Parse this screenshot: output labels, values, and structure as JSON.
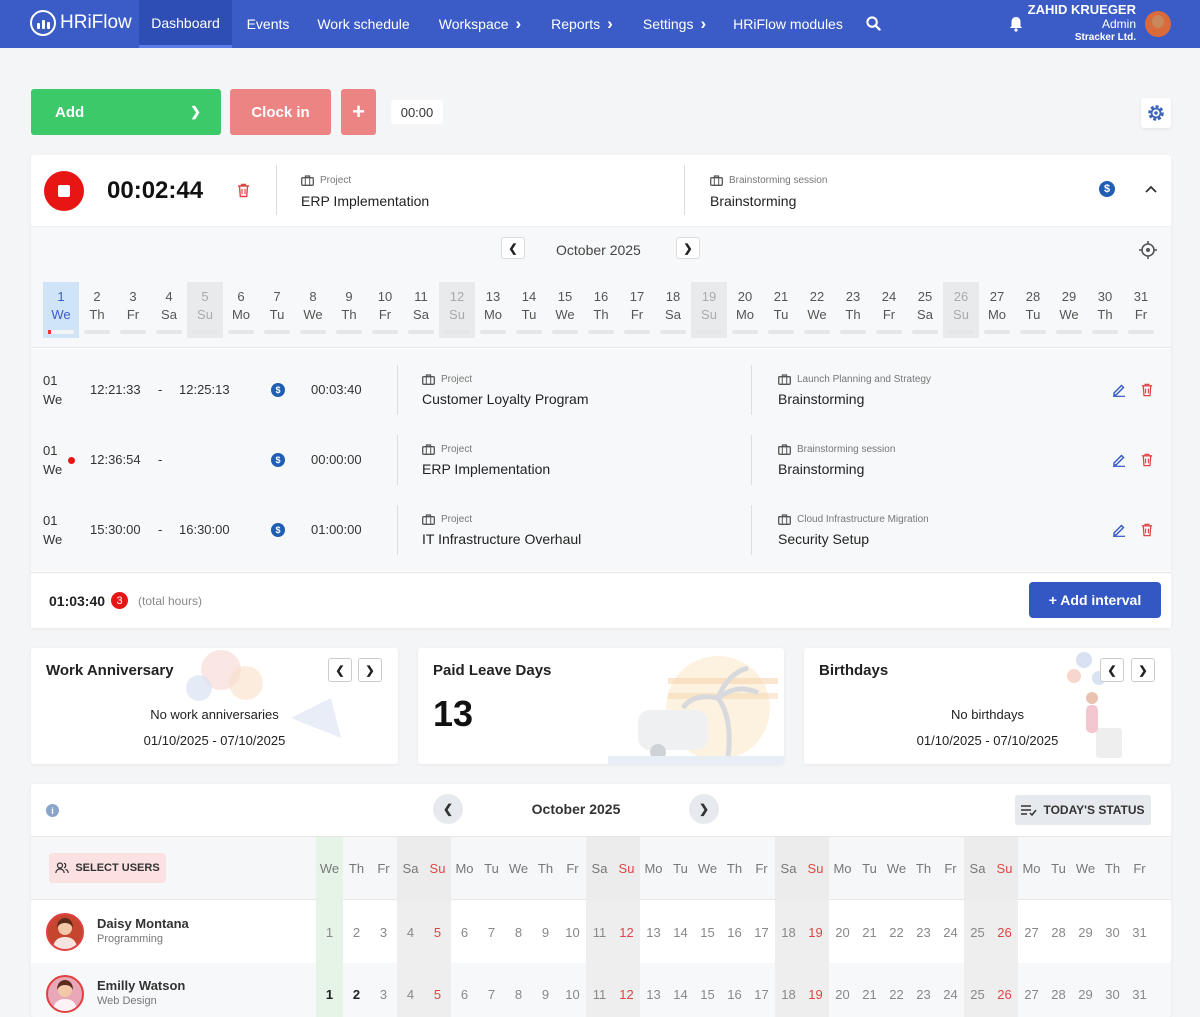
{
  "nav": {
    "brand": "HRiFlow",
    "items": [
      {
        "label": "Dashboard",
        "chevron": false
      },
      {
        "label": "Events",
        "chevron": false
      },
      {
        "label": "Work schedule",
        "chevron": false
      },
      {
        "label": "Workspace",
        "chevron": true
      },
      {
        "label": "Reports",
        "chevron": true
      },
      {
        "label": "Settings",
        "chevron": true
      },
      {
        "label": "HRiFlow modules",
        "chevron": false
      }
    ],
    "user": {
      "name": "ZAHID KRUEGER",
      "role": "Admin",
      "company": "Stracker Ltd."
    }
  },
  "actions": {
    "add": "Add",
    "clock_in": "Clock in",
    "plus": "+",
    "time": "00:00"
  },
  "tracker": {
    "elapsed": "00:02:44",
    "project_label": "Project",
    "project_value": "ERP Implementation",
    "task_label": "Brainstorming session",
    "task_value": "Brainstorming",
    "currency_symbol": "$"
  },
  "calendar": {
    "month": "October 2025",
    "days": [
      {
        "n": "1",
        "w": "We",
        "type": "today"
      },
      {
        "n": "2",
        "w": "Th",
        "type": ""
      },
      {
        "n": "3",
        "w": "Fr",
        "type": ""
      },
      {
        "n": "4",
        "w": "Sa",
        "type": ""
      },
      {
        "n": "5",
        "w": "Su",
        "type": "weekend"
      },
      {
        "n": "6",
        "w": "Mo",
        "type": ""
      },
      {
        "n": "7",
        "w": "Tu",
        "type": ""
      },
      {
        "n": "8",
        "w": "We",
        "type": ""
      },
      {
        "n": "9",
        "w": "Th",
        "type": ""
      },
      {
        "n": "10",
        "w": "Fr",
        "type": ""
      },
      {
        "n": "11",
        "w": "Sa",
        "type": ""
      },
      {
        "n": "12",
        "w": "Su",
        "type": "weekend"
      },
      {
        "n": "13",
        "w": "Mo",
        "type": ""
      },
      {
        "n": "14",
        "w": "Tu",
        "type": ""
      },
      {
        "n": "15",
        "w": "We",
        "type": ""
      },
      {
        "n": "16",
        "w": "Th",
        "type": ""
      },
      {
        "n": "17",
        "w": "Fr",
        "type": ""
      },
      {
        "n": "18",
        "w": "Sa",
        "type": ""
      },
      {
        "n": "19",
        "w": "Su",
        "type": "weekend"
      },
      {
        "n": "20",
        "w": "Mo",
        "type": ""
      },
      {
        "n": "21",
        "w": "Tu",
        "type": ""
      },
      {
        "n": "22",
        "w": "We",
        "type": ""
      },
      {
        "n": "23",
        "w": "Th",
        "type": ""
      },
      {
        "n": "24",
        "w": "Fr",
        "type": ""
      },
      {
        "n": "25",
        "w": "Sa",
        "type": ""
      },
      {
        "n": "26",
        "w": "Su",
        "type": "weekend"
      },
      {
        "n": "27",
        "w": "Mo",
        "type": ""
      },
      {
        "n": "28",
        "w": "Tu",
        "type": ""
      },
      {
        "n": "29",
        "w": "We",
        "type": ""
      },
      {
        "n": "30",
        "w": "Th",
        "type": ""
      },
      {
        "n": "31",
        "w": "Fr",
        "type": ""
      }
    ]
  },
  "intervals": [
    {
      "day": "01",
      "weekday": "We",
      "start": "12:21:33",
      "dash": "-",
      "end": "12:25:13",
      "duration": "00:03:40",
      "project_label": "Project",
      "project": "Customer Loyalty Program",
      "task_label": "Launch Planning and Strategy",
      "task": "Brainstorming",
      "recording": false
    },
    {
      "day": "01",
      "weekday": "We",
      "start": "12:36:54",
      "dash": "-",
      "end": "",
      "duration": "00:00:00",
      "project_label": "Project",
      "project": "ERP Implementation",
      "task_label": "Brainstorming session",
      "task": "Brainstorming",
      "recording": true
    },
    {
      "day": "01",
      "weekday": "We",
      "start": "15:30:00",
      "dash": "-",
      "end": "16:30:00",
      "duration": "01:00:00",
      "project_label": "Project",
      "project": "IT Infrastructure Overhaul",
      "task_label": "Cloud Infrastructure Migration",
      "task": "Security Setup",
      "recording": false
    }
  ],
  "totals": {
    "hours": "01:03:40",
    "count": "3",
    "caption": "(total hours)",
    "add_interval": "+ Add interval"
  },
  "widgets": {
    "anniversary": {
      "title": "Work Anniversary",
      "message": "No work anniversaries",
      "range": "01/10/2025 - 07/10/2025"
    },
    "paid_leave": {
      "title": "Paid Leave Days",
      "value": "13"
    },
    "birthdays": {
      "title": "Birthdays",
      "message": "No birthdays",
      "range": "01/10/2025 - 07/10/2025"
    }
  },
  "team": {
    "month": "October 2025",
    "status_button": "TODAY'S STATUS",
    "select_users": "SELECT USERS",
    "info": "i",
    "columns": [
      {
        "w": "We",
        "n": "1",
        "t": "today"
      },
      {
        "w": "Th",
        "n": "2",
        "t": ""
      },
      {
        "w": "Fr",
        "n": "3",
        "t": ""
      },
      {
        "w": "Sa",
        "n": "4",
        "t": "wk"
      },
      {
        "w": "Su",
        "n": "5",
        "t": "wk sun"
      },
      {
        "w": "Mo",
        "n": "6",
        "t": ""
      },
      {
        "w": "Tu",
        "n": "7",
        "t": ""
      },
      {
        "w": "We",
        "n": "8",
        "t": ""
      },
      {
        "w": "Th",
        "n": "9",
        "t": ""
      },
      {
        "w": "Fr",
        "n": "10",
        "t": ""
      },
      {
        "w": "Sa",
        "n": "11",
        "t": "wk"
      },
      {
        "w": "Su",
        "n": "12",
        "t": "wk sun"
      },
      {
        "w": "Mo",
        "n": "13",
        "t": ""
      },
      {
        "w": "Tu",
        "n": "14",
        "t": ""
      },
      {
        "w": "We",
        "n": "15",
        "t": ""
      },
      {
        "w": "Th",
        "n": "16",
        "t": ""
      },
      {
        "w": "Fr",
        "n": "17",
        "t": ""
      },
      {
        "w": "Sa",
        "n": "18",
        "t": "wk"
      },
      {
        "w": "Su",
        "n": "19",
        "t": "wk sun"
      },
      {
        "w": "Mo",
        "n": "20",
        "t": ""
      },
      {
        "w": "Tu",
        "n": "21",
        "t": ""
      },
      {
        "w": "We",
        "n": "22",
        "t": ""
      },
      {
        "w": "Th",
        "n": "23",
        "t": ""
      },
      {
        "w": "Fr",
        "n": "24",
        "t": ""
      },
      {
        "w": "Sa",
        "n": "25",
        "t": "wk"
      },
      {
        "w": "Su",
        "n": "26",
        "t": "wk sun"
      },
      {
        "w": "Mo",
        "n": "27",
        "t": ""
      },
      {
        "w": "Tu",
        "n": "28",
        "t": ""
      },
      {
        "w": "We",
        "n": "29",
        "t": ""
      },
      {
        "w": "Th",
        "n": "30",
        "t": ""
      },
      {
        "w": "Fr",
        "n": "31",
        "t": ""
      }
    ],
    "users": [
      {
        "name": "Daisy Montana",
        "dept": "Programming",
        "avatar_color": "#c6452f",
        "bold_days": []
      },
      {
        "name": "Emilly Watson",
        "dept": "Web Design",
        "avatar_color": "#e8a8b8",
        "bold_days": [
          "1",
          "2"
        ]
      }
    ]
  }
}
